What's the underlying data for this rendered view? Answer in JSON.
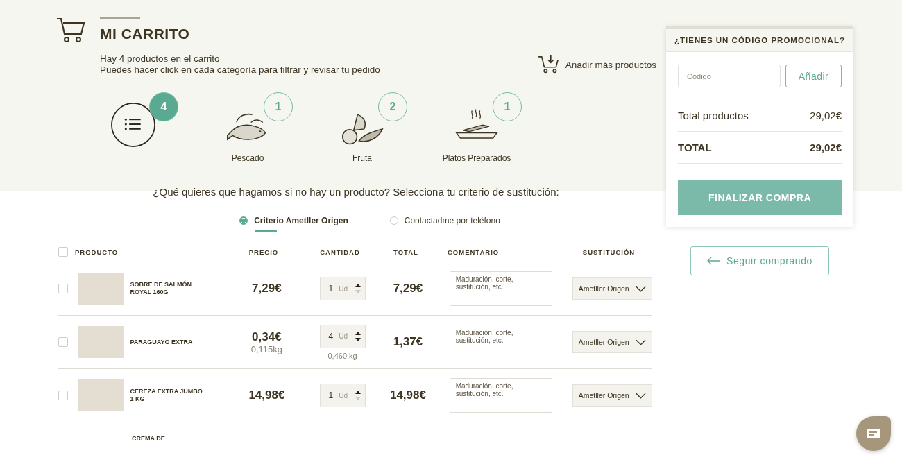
{
  "header": {
    "title": "MI CARRITO",
    "summary": "Hay 4 productos en el carrito",
    "hint": "Puedes hacer click en cada categoría para filtrar y revisar tu pedido",
    "add_link": "Añadir más productos"
  },
  "categories": [
    {
      "kind": "all",
      "count": "4",
      "selected": true
    },
    {
      "kind": "fish",
      "label": "Pescado",
      "count": "1",
      "selected": false
    },
    {
      "kind": "fruit",
      "label": "Fruta",
      "count": "2",
      "selected": false
    },
    {
      "kind": "dish",
      "label": "Platos Preparados",
      "count": "1",
      "selected": false
    }
  ],
  "substitution": {
    "question": "¿Qué quieres que hagamos si no hay un producto? Selecciona tu criterio de sustitución:",
    "options": [
      {
        "label": "Criterio Ametller Origen",
        "selected": true
      },
      {
        "label": "Contactadme por teléfono",
        "selected": false
      }
    ]
  },
  "table": {
    "select_all_checked": false,
    "columns": [
      "PRODUCTO",
      "PRECIO",
      "CANTIDAD",
      "TOTAL",
      "COMENTARIO",
      "SUSTITUCIÓN"
    ],
    "rows": [
      {
        "checked": false,
        "name": "SOBRE DE SALMÓN ROYAL 160G",
        "price": "7,29€",
        "quantity": "1",
        "unit": "Ud",
        "decrement_disabled": true,
        "total": "7,29€",
        "comment_placeholder": "Maduración, corte, sustitución, etc.",
        "substitution": "Ametller Origen"
      },
      {
        "checked": false,
        "name": "PARAGUAYO EXTRA",
        "price": "0,34€",
        "unit_weight": "0,115kg",
        "quantity": "4",
        "unit": "Ud",
        "quantity_weight": "0,460 kg",
        "decrement_disabled": false,
        "total": "1,37€",
        "comment_placeholder": "Maduración, corte, sustitución, etc.",
        "substitution": "Ametller Origen"
      },
      {
        "checked": false,
        "name": "CEREZA EXTRA JUMBO 1 KG",
        "price": "14,98€",
        "quantity": "1",
        "unit": "Ud",
        "decrement_disabled": true,
        "total": "14,98€",
        "comment_placeholder": "Maduración, corte, sustitución, etc.",
        "substitution": "Ametller Origen"
      }
    ],
    "partial_row": {
      "name": "CREMA DE"
    }
  },
  "promo": {
    "title": "¿TIENES UN CÓDIGO PROMOCIONAL?",
    "placeholder": "Codigo",
    "apply": "Añadir",
    "subtotal_label": "Total productos",
    "subtotal": "29,02€",
    "total_label": "TOTAL",
    "total": "29,02€",
    "checkout": "FINALIZAR COMPRA"
  },
  "continue": "Seguir comprando"
}
